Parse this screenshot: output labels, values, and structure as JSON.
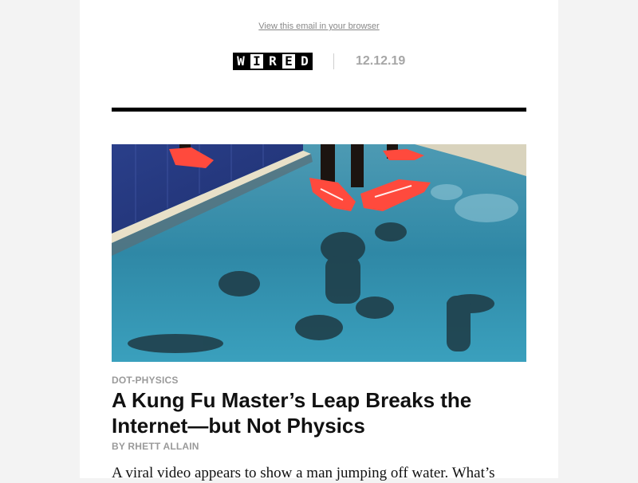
{
  "header": {
    "view_in_browser": "View this email in your browser",
    "logo_letters": [
      "W",
      "I",
      "R",
      "E",
      "D"
    ],
    "date": "12.12.19"
  },
  "hero_image": {
    "icon": "photo-of-sprinters-feet-reflected-in-water"
  },
  "article": {
    "category": "DOT-PHYSICS",
    "headline": "A Kung Fu Master’s Leap Breaks the Internet—but Not Physics",
    "byline": "BY RHETT ALLAIN",
    "dek": "A viral video appears to show a man jumping off water. What’s"
  },
  "colors": {
    "page_background": "#f3f3f3",
    "card_background": "#ffffff",
    "water": "#2f7e9a",
    "shoe_accent": "#ff4a3d",
    "muted_text": "#9a9a9a"
  }
}
